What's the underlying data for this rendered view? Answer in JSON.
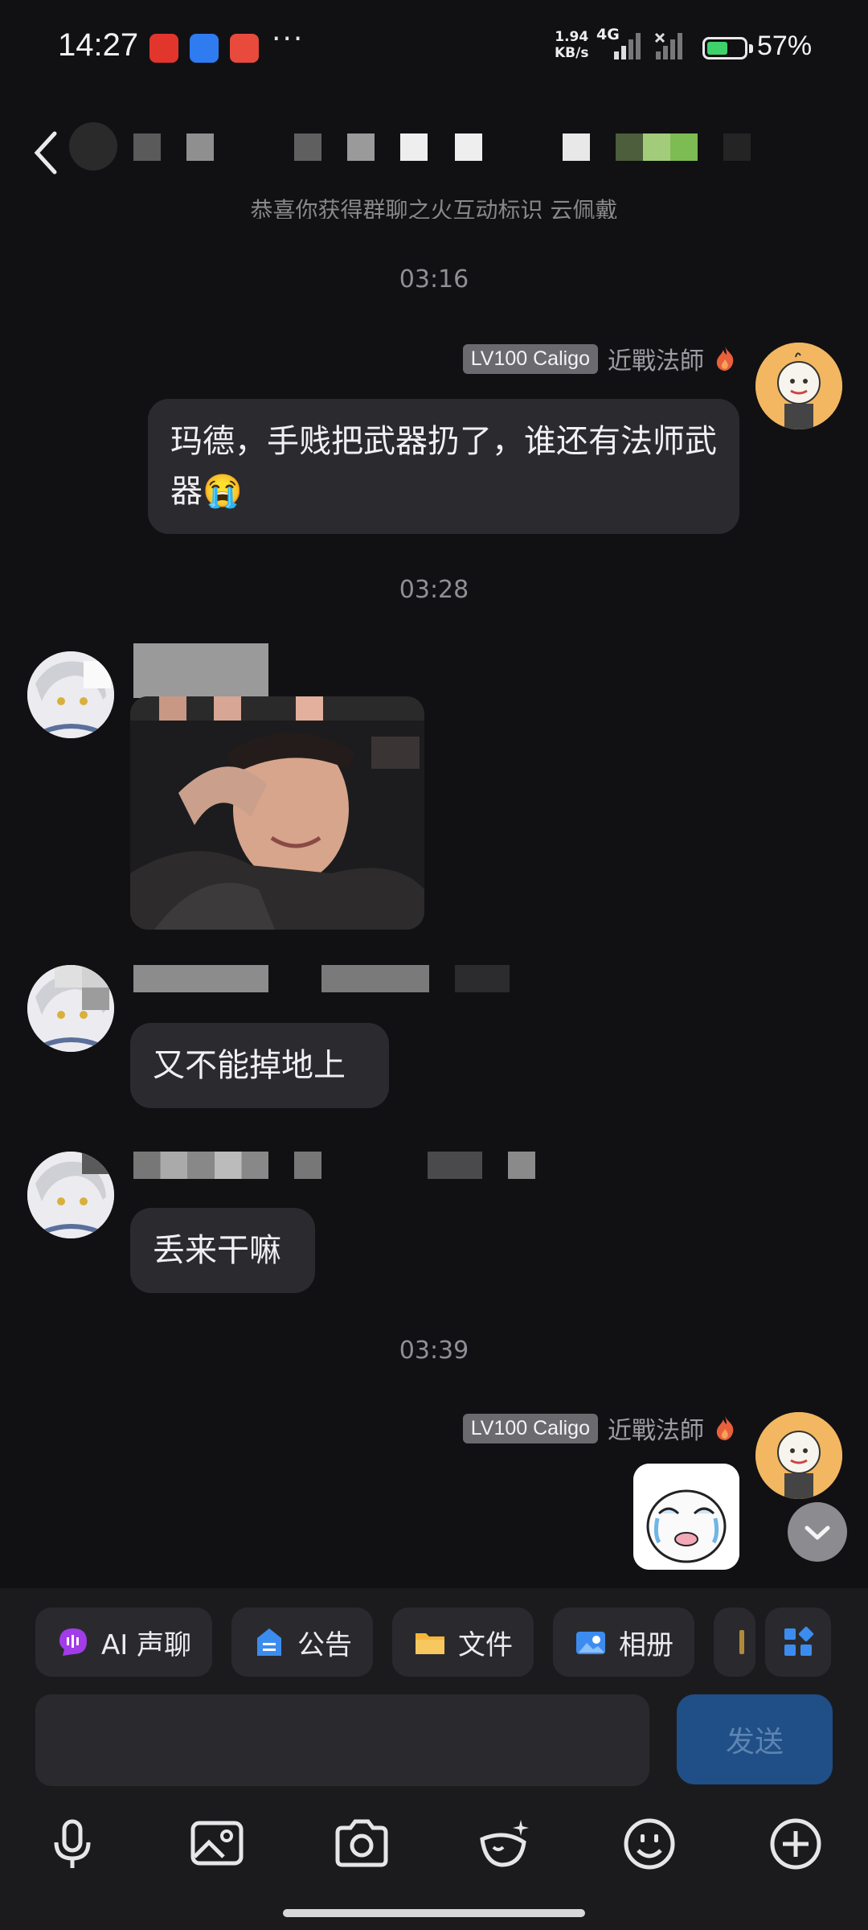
{
  "status_bar": {
    "time": "14:27",
    "dots": "···",
    "net_speed_value": "1.94",
    "net_speed_unit": "KB/s",
    "network": "4G",
    "battery_percent": "57%",
    "battery_level": 0.57,
    "colors": {
      "battery_fill": "#40d26a"
    }
  },
  "header": {
    "title_visible": "1",
    "back_icon": "chevron-left-icon"
  },
  "notice": {
    "text": "恭喜你获得群聊之火互动标识 云佩戴"
  },
  "messages": {
    "time_1": "03:16",
    "self_tag_1": {
      "level": "LV100 Caligo",
      "nickname": "近戰法師"
    },
    "self_text_1": "玛德，手贱把武器扔了，谁还有法师武器😭",
    "time_2": "03:28",
    "reply_1": "又不能掉地上",
    "reply_2": "丢来干嘛",
    "time_3": "03:39",
    "self_tag_2": {
      "level": "LV100 Caligo",
      "nickname": "近戰法師"
    }
  },
  "quick_actions": [
    {
      "label": "AI 声聊",
      "icon": "ai-voice-icon"
    },
    {
      "label": "公告",
      "icon": "announcement-icon"
    },
    {
      "label": "文件",
      "icon": "folder-icon"
    },
    {
      "label": "相册",
      "icon": "album-icon"
    }
  ],
  "composer": {
    "input_placeholder": "",
    "send_label": "发送"
  },
  "toolbar_icons": [
    "microphone-icon",
    "image-icon",
    "camera-icon",
    "magic-sticker-icon",
    "emoji-icon",
    "plus-icon"
  ],
  "colors": {
    "background": "#111114",
    "bubble": "#2b2b2f",
    "send_button": "#1f4f86"
  }
}
